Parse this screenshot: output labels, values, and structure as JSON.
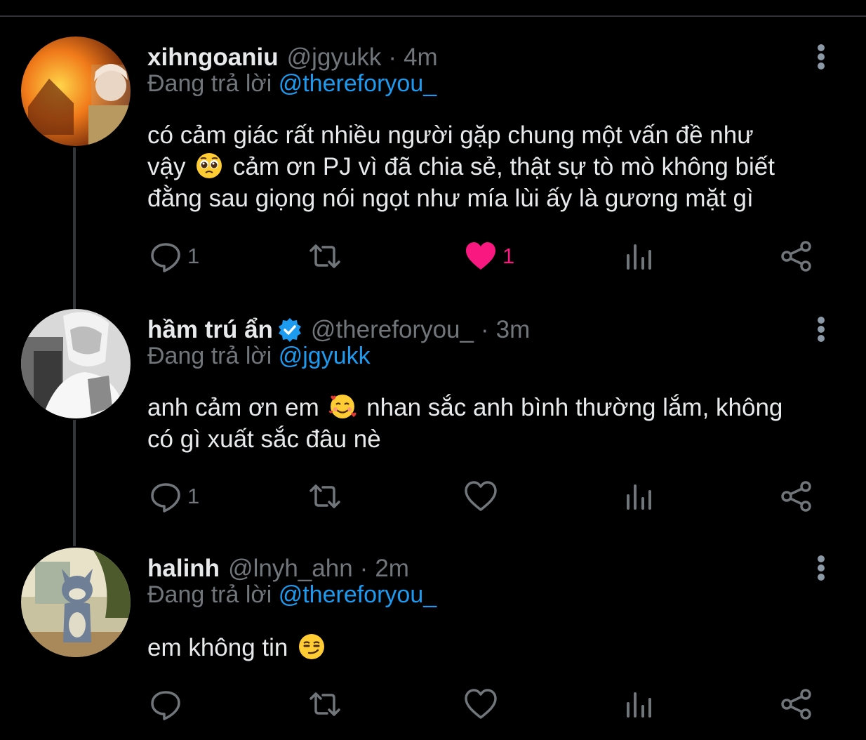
{
  "colors": {
    "background": "#000000",
    "text": "#e7e9ea",
    "muted": "#71767b",
    "mention": "#1d9bf0",
    "like": "#f91880",
    "verified": "#1d9bf0"
  },
  "replying_prefix": "Đang trả lời",
  "tweets": [
    {
      "name": "xihngoaniu",
      "handle": "@jgyukk",
      "separator": "·",
      "time": "4m",
      "reply_to": "@thereforyou_",
      "text_lines": [
        "có cảm giác rất nhiều người gặp chung một vấn đề như",
        "vậy",
        "cảm ơn PJ vì đã chia sẻ, thật sự tò mò không biết",
        "đằng sau giọng nói ngọt như mía lùi ấy là gương mặt gì"
      ],
      "emoji": "pleading-face",
      "replies": "1",
      "likes": "1",
      "liked": true
    },
    {
      "name": "hầm trú ẩn",
      "handle": "@thereforyou_",
      "separator": "·",
      "time": "3m",
      "verified": true,
      "reply_to": "@jgyukk",
      "text_lines": [
        "anh cảm ơn em",
        "nhan sắc anh bình thường lắm, không",
        "có gì xuất sắc đâu nè"
      ],
      "emoji": "smiling-face-with-hearts",
      "replies": "1",
      "likes": "",
      "liked": false
    },
    {
      "name": "halinh",
      "handle": "@lnyh_ahn",
      "separator": "·",
      "time": "2m",
      "reply_to": "@thereforyou_",
      "text_lines": [
        "em không tin"
      ],
      "emoji": "smirking-face",
      "replies": "",
      "likes": "",
      "liked": false
    }
  ],
  "icons": [
    "reply-icon",
    "retweet-icon",
    "like-icon",
    "views-icon",
    "share-icon",
    "more-icon",
    "verified-icon"
  ]
}
